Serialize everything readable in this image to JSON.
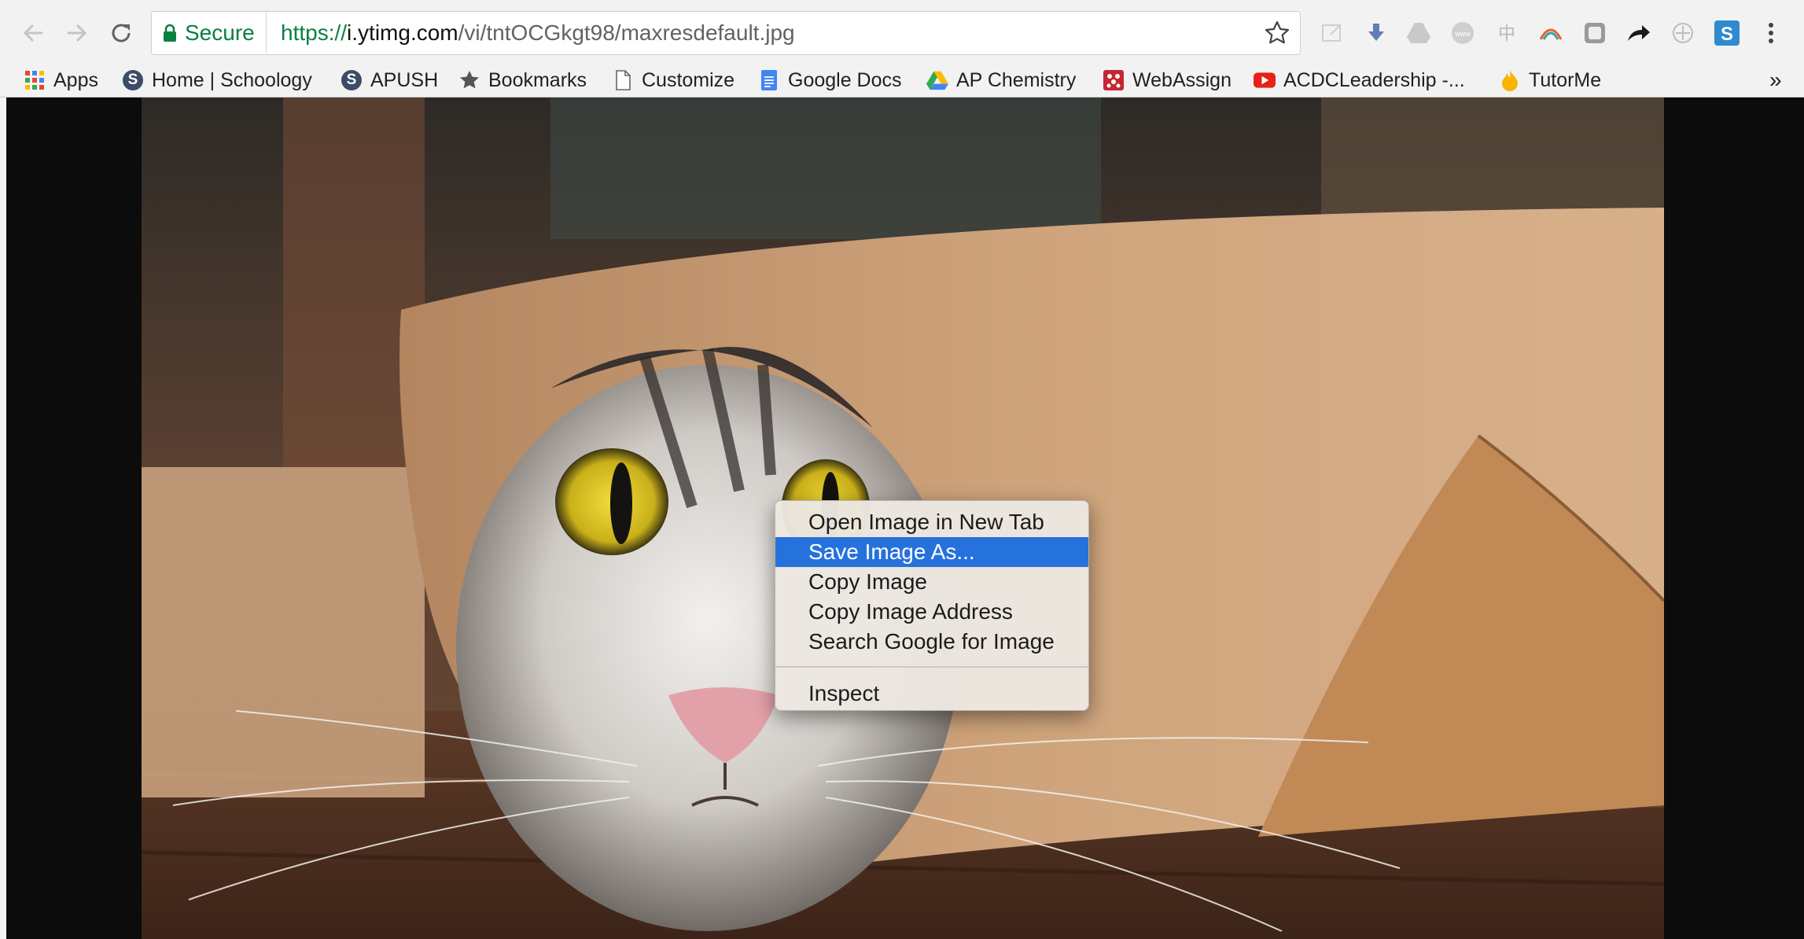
{
  "browser": {
    "security_label": "Secure",
    "url": {
      "scheme": "https://",
      "host": "i.ytimg.com",
      "path": "/vi/tntOCGkgt98/maxresdefault.jpg"
    }
  },
  "bookmarks": [
    {
      "label": "Apps",
      "icon": "apps-grid-icon"
    },
    {
      "label": "Home | Schoology",
      "icon": "schoology-icon"
    },
    {
      "label": "APUSH",
      "icon": "schoology-icon"
    },
    {
      "label": "Bookmarks",
      "icon": "star-icon"
    },
    {
      "label": "Customize",
      "icon": "page-icon"
    },
    {
      "label": "Google Docs",
      "icon": "google-docs-icon"
    },
    {
      "label": "AP Chemistry",
      "icon": "google-drive-icon"
    },
    {
      "label": "WebAssign",
      "icon": "webassign-icon"
    },
    {
      "label": "ACDCLeadership -...",
      "icon": "youtube-icon"
    },
    {
      "label": "TutorMe",
      "icon": "tutorme-icon"
    }
  ],
  "overflow_label": "»",
  "context_menu": {
    "items": [
      "Open Image in New Tab",
      "Save Image As...",
      "Copy Image",
      "Copy Image Address",
      "Search Google for Image",
      "Inspect"
    ],
    "selected_item": "Save Image As..."
  },
  "colors": {
    "secure_green": "#0b8043",
    "selection_blue": "#2672dc",
    "toolbar_bg": "#f2f2f2"
  }
}
